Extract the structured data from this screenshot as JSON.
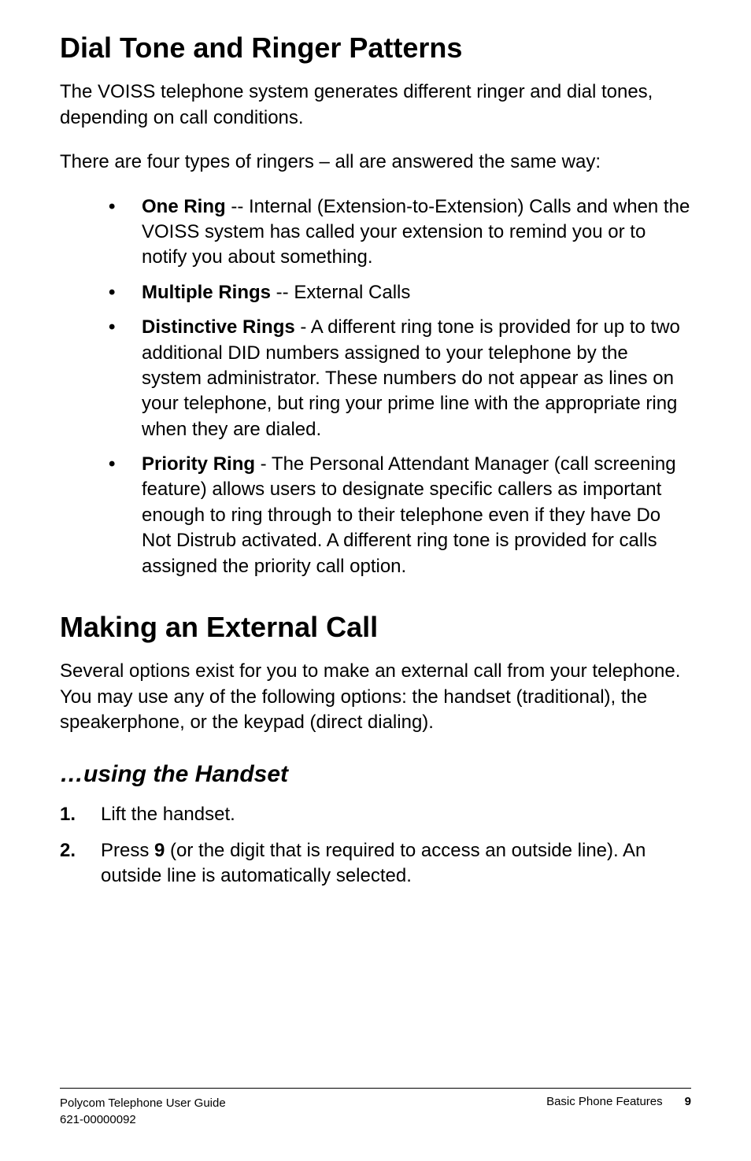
{
  "section1": {
    "title": "Dial Tone and Ringer Patterns",
    "intro": "The VOISS telephone system generates different ringer and dial tones, depending on call conditions.",
    "types_intro": "There are four types of ringers – all are answered the same way:",
    "bullets": [
      {
        "label": "One Ring",
        "desc": " -- Internal (Extension-to-Extension) Calls and when the VOISS system has called your extension to remind you or to notify you about something."
      },
      {
        "label": "Multiple Rings",
        "desc": " -- External Calls"
      },
      {
        "label": "Distinctive Rings",
        "desc": " - A different ring tone is provided for up to two additional DID numbers assigned to your telephone by the system administrator. These numbers do not appear as lines on your telephone, but ring your prime line with the appropriate ring when they are dialed."
      },
      {
        "label": "Priority Ring",
        "desc": " - The Personal Attendant Manager (call screening feature) allows users to designate specific callers as important enough to ring through to their telephone even if they have Do Not Distrub activated. A different ring tone is provided for calls assigned the priority call option."
      }
    ]
  },
  "section2": {
    "title": "Making an External Call",
    "intro": "Several options exist for you to make an external call from your telephone. You may use any of the following options: the handset (traditional), the speakerphone, or the keypad (direct dialing).",
    "subheading": "…using the Handset",
    "steps": [
      {
        "num": "1.",
        "prefix": "Lift the handset.",
        "bold": "",
        "suffix": ""
      },
      {
        "num": "2.",
        "prefix": "Press ",
        "bold": "9",
        "suffix": " (or the digit that is required to access an outside line). An outside line is automatically selected."
      }
    ]
  },
  "footer": {
    "left_line1": "Polycom Telephone User Guide",
    "left_line2": "621-00000092",
    "right_label": "Basic Phone Features",
    "page_number": "9"
  }
}
